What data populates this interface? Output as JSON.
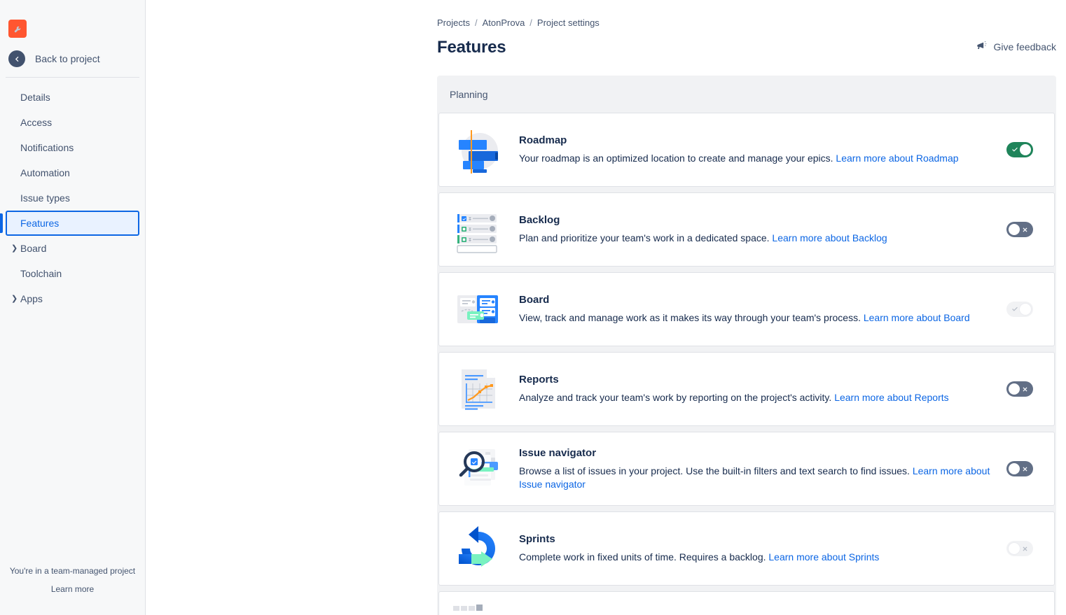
{
  "sidebar": {
    "logo_icon": "wrench-icon",
    "logo_color": "#ff5630",
    "back_label": "Back to project",
    "back_icon": "arrow-left-circle-icon",
    "items": [
      {
        "label": "Details",
        "expandable": false,
        "selected": false
      },
      {
        "label": "Access",
        "expandable": false,
        "selected": false
      },
      {
        "label": "Notifications",
        "expandable": false,
        "selected": false
      },
      {
        "label": "Automation",
        "expandable": false,
        "selected": false
      },
      {
        "label": "Issue types",
        "expandable": false,
        "selected": false
      },
      {
        "label": "Features",
        "expandable": false,
        "selected": true
      },
      {
        "label": "Board",
        "expandable": true,
        "selected": false
      },
      {
        "label": "Toolchain",
        "expandable": false,
        "selected": false
      },
      {
        "label": "Apps",
        "expandable": true,
        "selected": false
      }
    ],
    "footer_note": "You're in a team-managed project",
    "footer_link": "Learn more"
  },
  "header": {
    "breadcrumb": [
      "Projects",
      "AtonProva",
      "Project settings"
    ],
    "separator": "/",
    "title": "Features",
    "feedback_label": "Give feedback",
    "feedback_icon": "megaphone-icon"
  },
  "sections": [
    {
      "name": "Planning",
      "features": [
        {
          "id": "roadmap",
          "icon": "roadmap-icon",
          "title": "Roadmap",
          "description": "Your roadmap is an optimized location to create and manage your epics.",
          "link": "Learn more about Roadmap",
          "toggle_state": "on",
          "toggle_enabled": true,
          "toggle_glyph": "check"
        },
        {
          "id": "backlog",
          "icon": "backlog-icon",
          "title": "Backlog",
          "description": "Plan and prioritize your team's work in a dedicated space.",
          "link": "Learn more about Backlog",
          "toggle_state": "off",
          "toggle_enabled": true,
          "toggle_glyph": "cross"
        },
        {
          "id": "board",
          "icon": "board-icon",
          "title": "Board",
          "description": "View, track and manage work as it makes its way through your team's process.",
          "link": "Learn more about Board",
          "toggle_state": "on",
          "toggle_enabled": false,
          "toggle_glyph": "check"
        },
        {
          "id": "reports",
          "icon": "reports-icon",
          "title": "Reports",
          "description": "Analyze and track your team's work by reporting on the project's activity.",
          "link": "Learn more about Reports",
          "toggle_state": "off",
          "toggle_enabled": true,
          "toggle_glyph": "cross"
        },
        {
          "id": "issue-navigator",
          "icon": "issue-navigator-icon",
          "title": "Issue navigator",
          "description": "Browse a list of issues in your project. Use the built-in filters and text search to find issues.",
          "link": "Learn more about Issue navigator",
          "toggle_state": "off",
          "toggle_enabled": true,
          "toggle_glyph": "cross"
        },
        {
          "id": "sprints",
          "icon": "sprints-icon",
          "title": "Sprints",
          "description": "Complete work in fixed units of time. Requires a backlog.",
          "link": "Learn more about Sprints",
          "toggle_state": "off",
          "toggle_enabled": false,
          "toggle_glyph": "cross"
        }
      ]
    }
  ],
  "colors": {
    "toggle_on": "#1f845a",
    "toggle_off": "#626f86",
    "toggle_disabled": "#f1f2f4",
    "link": "#0c66e4",
    "selected_nav_bg": "#e9f2ff",
    "selected_nav_border": "#0c66e4",
    "section_bg": "#f1f2f4",
    "sidebar_bg": "#f7f8f9"
  }
}
